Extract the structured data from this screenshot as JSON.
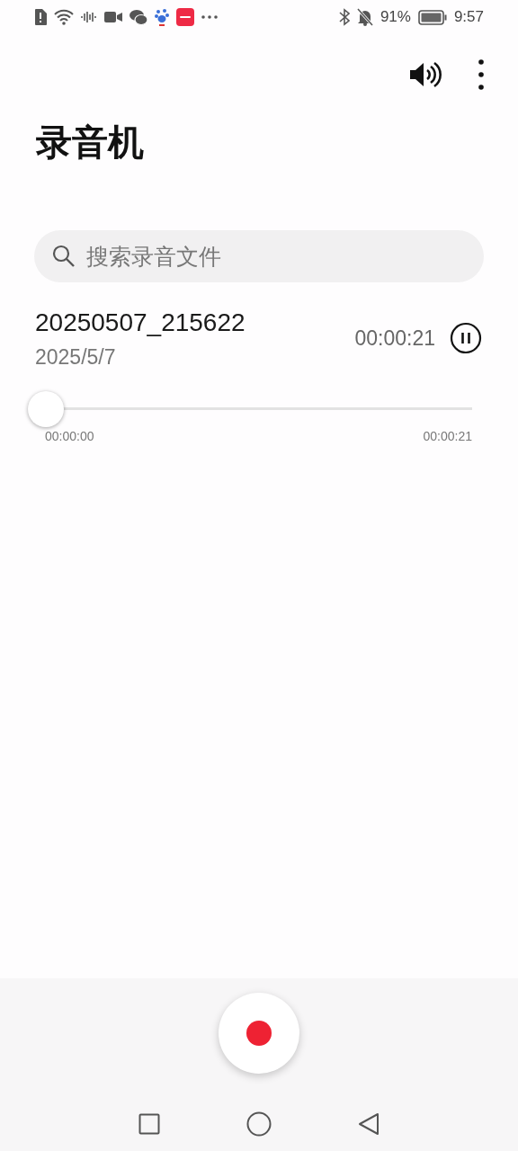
{
  "status_bar": {
    "battery": "91%",
    "time": "9:57"
  },
  "title": "录音机",
  "search": {
    "placeholder": "搜索录音文件"
  },
  "recordings": [
    {
      "name": "20250507_215622",
      "date": "2025/5/7",
      "duration": "00:00:21",
      "playing": true,
      "level": 0,
      "position": "00:00:00",
      "total": "00:00:21"
    }
  ]
}
